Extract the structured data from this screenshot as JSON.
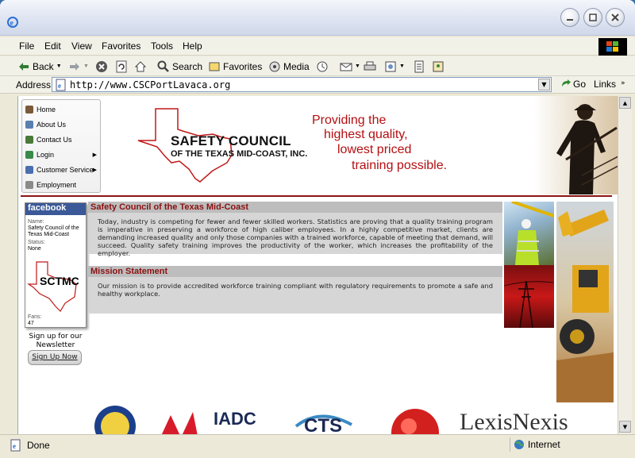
{
  "browser": {
    "menu": [
      "File",
      "Edit",
      "View",
      "Favorites",
      "Tools",
      "Help"
    ],
    "toolbar": {
      "back": "Back",
      "search": "Search",
      "favorites": "Favorites",
      "media": "Media"
    },
    "address": {
      "label": "Address",
      "url": "http://www.CSCPortLavaca.org",
      "go": "Go",
      "links": "Links"
    },
    "status": {
      "text": "Done",
      "zone": "Internet"
    }
  },
  "site": {
    "nav": [
      "Home",
      "About Us",
      "Contact Us",
      "Login",
      "Customer Service",
      "Employment"
    ],
    "logo": {
      "title": "SAFETY COUNCIL",
      "subtitle": "OF THE TEXAS MID-COAST, INC."
    },
    "tagline": [
      "Providing the",
      "highest quality,",
      "lowest priced",
      "training possible."
    ],
    "facebook": {
      "brand": "facebook",
      "name_label": "Name:",
      "name_value": "Safety Council of the Texas Mid-Coast",
      "status_label": "Status:",
      "status_value": "None",
      "logo_text": "SCTMC",
      "fans_label": "Fans:",
      "fans_value": "47"
    },
    "newsletter": "Sign up for our Newsletter",
    "signup_button": "Sign Up Now",
    "sections": [
      {
        "title": "Safety Council of the Texas Mid-Coast",
        "body": "Today, industry is competing for fewer and fewer skilled workers. Statistics are proving that a quality training program is imperative in preserving a workforce of high caliber employees. In a highly competitive market, clients are demanding increased quality and only those companies with a trained workforce, capable of meeting that demand, will succeed. Quality safety training improves the productivity of the worker, which increases the profitability of the employer."
      },
      {
        "title": "Mission Statement",
        "body": "Our mission is to provide accredited workforce training compliant with regulatory requirements to promote a safe and healthy workplace."
      }
    ],
    "partner_logos": [
      "IADC",
      "CTS",
      "LexisNexis"
    ]
  }
}
